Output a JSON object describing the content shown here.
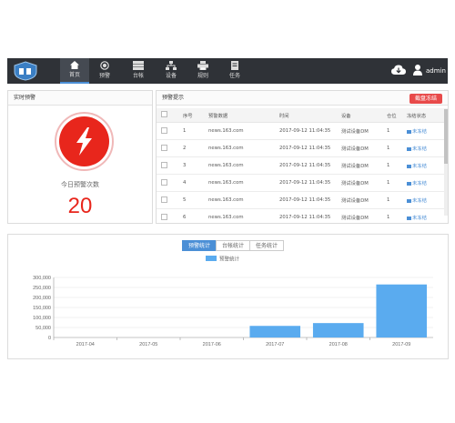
{
  "nav": {
    "items": [
      {
        "label": "首页",
        "icon": "home-icon"
      },
      {
        "label": "预警",
        "icon": "alert-icon"
      },
      {
        "label": "台帐",
        "icon": "ledger-icon"
      },
      {
        "label": "设备",
        "icon": "device-icon"
      },
      {
        "label": "规则",
        "icon": "rule-icon"
      },
      {
        "label": "任务",
        "icon": "task-icon"
      }
    ],
    "active": "首页",
    "user": "admin"
  },
  "realtime": {
    "title": "实时预警",
    "label": "今日预警次数",
    "count": "20",
    "accent": "#e8261c"
  },
  "alerts": {
    "title": "预警提示",
    "button": "截盘冻结",
    "columns": [
      "",
      "序号",
      "预警数据",
      "时间",
      "设备",
      "仓位",
      "冻结状态"
    ],
    "rows": [
      {
        "no": "1",
        "data": "news.163.com",
        "time": "2017-09-12 11:04:35",
        "device": "测试设备DM",
        "slot": "1",
        "status": "未冻结"
      },
      {
        "no": "2",
        "data": "news.163.com",
        "time": "2017-09-12 11:04:35",
        "device": "测试设备DM",
        "slot": "1",
        "status": "未冻结"
      },
      {
        "no": "3",
        "data": "news.163.com",
        "time": "2017-09-12 11:04:35",
        "device": "测试设备DM",
        "slot": "1",
        "status": "未冻结"
      },
      {
        "no": "4",
        "data": "news.163.com",
        "time": "2017-09-12 11:04:35",
        "device": "测试设备DM",
        "slot": "1",
        "status": "未冻结"
      },
      {
        "no": "5",
        "data": "news.163.com",
        "time": "2017-09-12 11:04:35",
        "device": "测试设备DM",
        "slot": "1",
        "status": "未冻结"
      },
      {
        "no": "6",
        "data": "news.163.com",
        "time": "2017-09-12 11:04:35",
        "device": "测试设备DM",
        "slot": "1",
        "status": "未冻结"
      }
    ]
  },
  "stats": {
    "tabs": [
      "预警统计",
      "台帐统计",
      "任务统计"
    ],
    "active_tab": "预警统计"
  },
  "chart_data": {
    "type": "bar",
    "categories": [
      "2017-04",
      "2017-05",
      "2017-06",
      "2017-07",
      "2017-08",
      "2017-09"
    ],
    "series": [
      {
        "name": "预警统计",
        "values": [
          0,
          0,
          0,
          58000,
          72000,
          265000
        ],
        "color": "#5aabef"
      }
    ],
    "ylim": [
      0,
      300000
    ],
    "yticks": [
      "0",
      "50,000",
      "100,000",
      "150,000",
      "200,000",
      "250,000",
      "300,000"
    ],
    "legend": "top-center",
    "grid": true
  }
}
